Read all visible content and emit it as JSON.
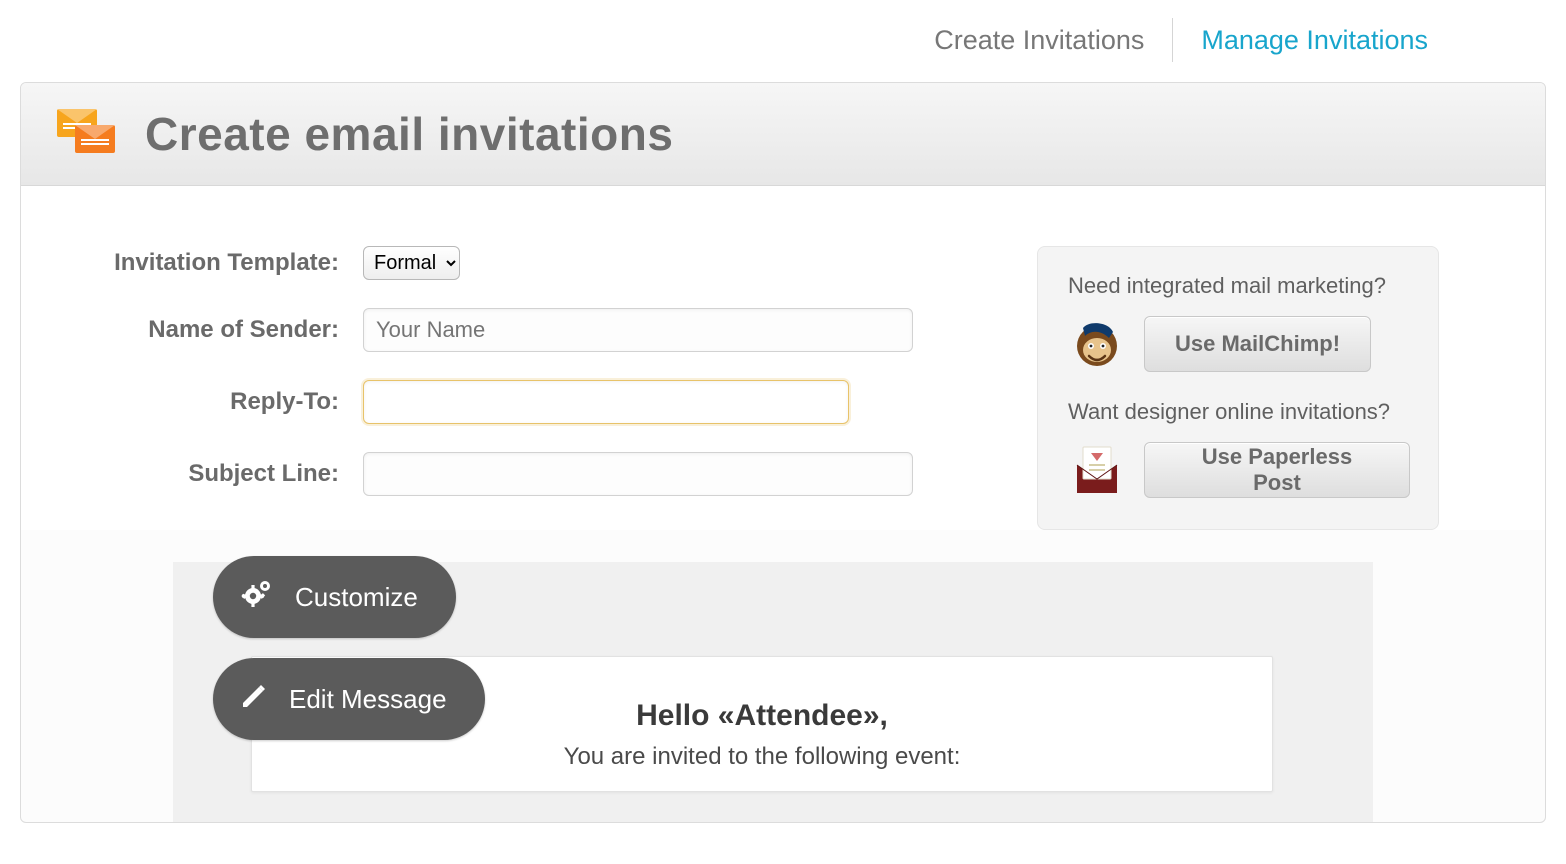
{
  "nav": {
    "create_label": "Create Invitations",
    "manage_label": "Manage Invitations",
    "active": "manage"
  },
  "header": {
    "title": "Create email invitations"
  },
  "form": {
    "template_label": "Invitation Template:",
    "template_selected": "Formal",
    "template_options": [
      "Formal"
    ],
    "sender_label": "Name of Sender:",
    "sender_placeholder": "Your Name",
    "sender_value": "",
    "replyto_label": "Reply-To:",
    "replyto_value": "",
    "subject_label": "Subject Line:",
    "subject_value": ""
  },
  "sidebar": {
    "q1": "Need integrated mail marketing?",
    "btn1": "Use MailChimp!",
    "q2": "Want designer online invitations?",
    "btn2": "Use Paperless Post"
  },
  "preview": {
    "customize_label": "Customize",
    "edit_label": "Edit Message",
    "greeting": "Hello  «Attendee»,",
    "subline": "You are invited to the following event:"
  },
  "icons": {
    "envelope_stack": "envelope-stack-icon",
    "gear": "gear-icon",
    "pencil": "pencil-icon",
    "mailchimp": "mailchimp-logo",
    "paperless": "paperless-post-logo"
  }
}
